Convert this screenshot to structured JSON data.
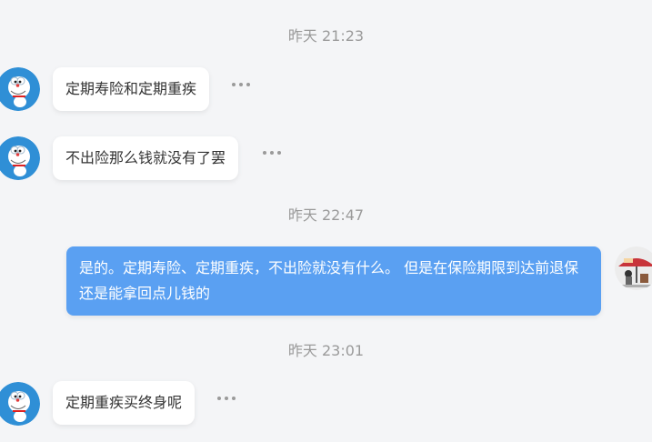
{
  "messages": [
    {
      "type": "timestamp",
      "text": "昨天 21:23"
    },
    {
      "type": "incoming",
      "text": "定期寿险和定期重疾"
    },
    {
      "type": "incoming",
      "text": "不出险那么钱就没有了罢"
    },
    {
      "type": "timestamp",
      "text": "昨天 22:47"
    },
    {
      "type": "outgoing",
      "text": "是的。定期寿险、定期重疾，不出险就没有什么。 但是在保险期限到达前退保还是能拿回点儿钱的"
    },
    {
      "type": "timestamp",
      "text": "昨天 23:01"
    },
    {
      "type": "incoming",
      "text": "定期重疾买终身呢"
    }
  ],
  "icons": {
    "incoming_avatar": "doraemon-avatar-icon",
    "outgoing_avatar": "user-avatar-icon",
    "more": "more-options-icon"
  },
  "colors": {
    "background": "#f4f5f7",
    "outgoing_bubble": "#5aa0f2",
    "incoming_bubble": "#ffffff",
    "timestamp": "#9a9a9a"
  }
}
